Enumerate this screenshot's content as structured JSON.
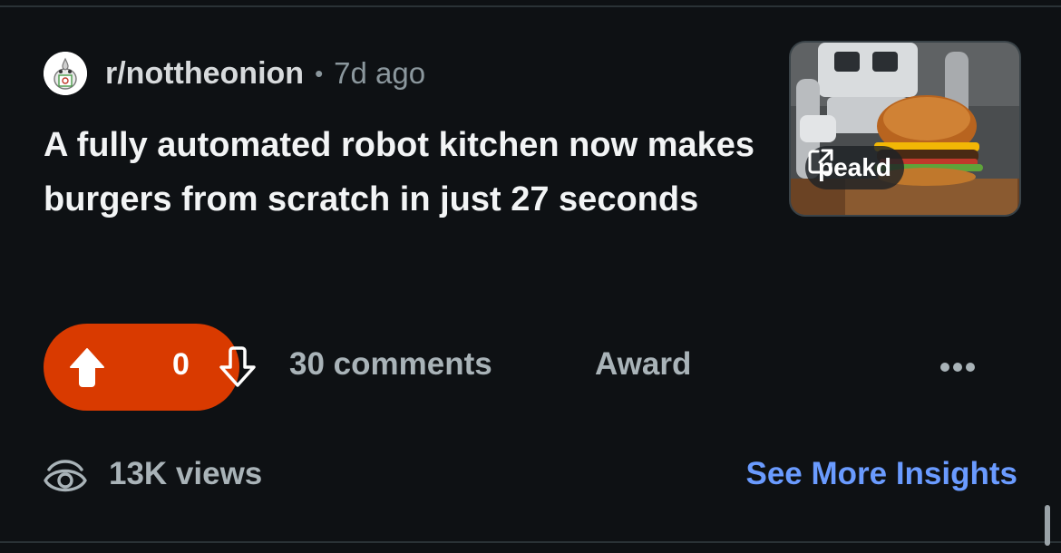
{
  "post": {
    "subreddit": "r/nottheonion",
    "separator": "•",
    "age": "7d ago",
    "title": "A fully automated robot kitchen now makes burgers from scratch in just 27 seconds",
    "link_domain": "peakd"
  },
  "actions": {
    "vote_count": "0",
    "comments_label": "30 comments",
    "award_label": "Award",
    "more_icon": "ellipsis-icon"
  },
  "stats": {
    "views_label": "13K views",
    "insights_label": "See More Insights"
  },
  "colors": {
    "background": "#0e1114",
    "vote_active": "#d93a00",
    "link": "#6a9bff",
    "muted_text": "#a9b3b8"
  }
}
